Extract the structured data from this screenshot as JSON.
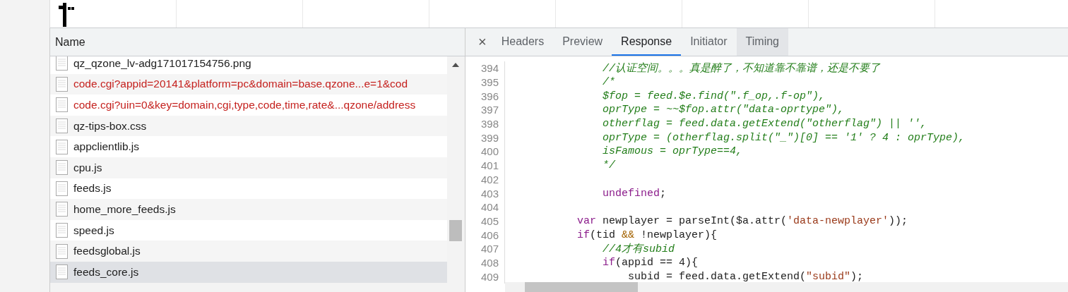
{
  "list_header": "Name",
  "files": [
    {
      "name": "qz_qzone_lv-adg171017154756.png",
      "error": false,
      "selected": false
    },
    {
      "name": "code.cgi?appid=20141&platform=pc&domain=base.qzone...e=1&cod",
      "error": true,
      "selected": false
    },
    {
      "name": "code.cgi?uin=0&key=domain,cgi,type,code,time,rate&...qzone/address",
      "error": true,
      "selected": false
    },
    {
      "name": "qz-tips-box.css",
      "error": false,
      "selected": false
    },
    {
      "name": "appclientlib.js",
      "error": false,
      "selected": false
    },
    {
      "name": "cpu.js",
      "error": false,
      "selected": false
    },
    {
      "name": "feeds.js",
      "error": false,
      "selected": false
    },
    {
      "name": "home_more_feeds.js",
      "error": false,
      "selected": false
    },
    {
      "name": "speed.js",
      "error": false,
      "selected": false
    },
    {
      "name": "feedsglobal.js",
      "error": false,
      "selected": false
    },
    {
      "name": "feeds_core.js",
      "error": false,
      "selected": true
    }
  ],
  "close_glyph": "×",
  "tabs": [
    {
      "label": "Headers",
      "selected": false,
      "hovered": false
    },
    {
      "label": "Preview",
      "selected": false,
      "hovered": false
    },
    {
      "label": "Response",
      "selected": true,
      "hovered": false
    },
    {
      "label": "Initiator",
      "selected": false,
      "hovered": false
    },
    {
      "label": "Timing",
      "selected": false,
      "hovered": true
    }
  ],
  "code_lines": [
    {
      "number": "394",
      "tokens": [
        {
          "kind": "comment",
          "text": "            //认证空间。。。真是醉了，不知道靠不靠谱，还是不要了"
        }
      ]
    },
    {
      "number": "395",
      "tokens": [
        {
          "kind": "comment",
          "text": "            /*"
        }
      ]
    },
    {
      "number": "396",
      "tokens": [
        {
          "kind": "comment",
          "text": "            $fop = feed.$e.find(\".f_op,.f-op\"),"
        }
      ]
    },
    {
      "number": "397",
      "tokens": [
        {
          "kind": "comment",
          "text": "            oprType = ~~$fop.attr(\"data-oprtype\"),"
        }
      ]
    },
    {
      "number": "398",
      "tokens": [
        {
          "kind": "comment",
          "text": "            otherflag = feed.data.getExtend(\"otherflag\") || '',"
        }
      ]
    },
    {
      "number": "399",
      "tokens": [
        {
          "kind": "comment",
          "text": "            oprType = (otherflag.split(\"_\")[0] == '1' ? 4 : oprType),"
        }
      ]
    },
    {
      "number": "400",
      "tokens": [
        {
          "kind": "comment",
          "text": "            isFamous = oprType==4,"
        }
      ]
    },
    {
      "number": "401",
      "tokens": [
        {
          "kind": "comment",
          "text": "            */"
        }
      ]
    },
    {
      "number": "402"
    },
    {
      "number": "403",
      "tokens": [
        {
          "kind": "keyword",
          "text": "            undefined"
        },
        {
          "kind": "plain",
          "text": ";"
        }
      ]
    },
    {
      "number": "404"
    },
    {
      "number": "405",
      "tokens": [
        {
          "kind": "keyword",
          "text": "        var"
        },
        {
          "kind": "plain",
          "text": " newplayer = parseInt($a.attr("
        },
        {
          "kind": "string",
          "text": "'data-newplayer'"
        },
        {
          "kind": "plain",
          "text": "));"
        }
      ]
    },
    {
      "number": "406",
      "tokens": [
        {
          "kind": "keyword",
          "text": "        if"
        },
        {
          "kind": "plain",
          "text": "(tid "
        },
        {
          "kind": "operator",
          "text": "&&"
        },
        {
          "kind": "plain",
          "text": " !newplayer){"
        }
      ]
    },
    {
      "number": "407",
      "tokens": [
        {
          "kind": "comment",
          "text": "            //4才有subid"
        }
      ]
    },
    {
      "number": "408",
      "tokens": [
        {
          "kind": "keyword",
          "text": "            if"
        },
        {
          "kind": "plain",
          "text": "(appid == 4){"
        }
      ]
    },
    {
      "number": "409",
      "tokens": [
        {
          "kind": "plain",
          "text": "                subid = feed.data.getExtend("
        },
        {
          "kind": "string",
          "text": "\"subid\""
        },
        {
          "kind": "plain",
          "text": ");"
        }
      ]
    }
  ]
}
